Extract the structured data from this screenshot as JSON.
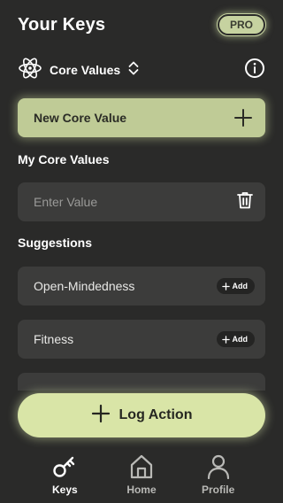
{
  "header": {
    "title": "Your Keys",
    "badge": "PRO"
  },
  "selector": {
    "label": "Core Values",
    "icon": "atom-icon"
  },
  "new_value_button": {
    "label": "New Core Value"
  },
  "my_values": {
    "title": "My Core Values",
    "input_placeholder": "Enter Value",
    "input_value": ""
  },
  "suggestions": {
    "title": "Suggestions",
    "add_label": "Add",
    "items": [
      {
        "label": "Open-Mindedness"
      },
      {
        "label": "Fitness"
      }
    ]
  },
  "log_action": {
    "label": "Log Action"
  },
  "nav": {
    "items": [
      {
        "label": "Keys",
        "icon": "key-icon",
        "active": true
      },
      {
        "label": "Home",
        "icon": "home-icon",
        "active": false
      },
      {
        "label": "Profile",
        "icon": "person-icon",
        "active": false
      }
    ]
  },
  "colors": {
    "background": "#2a2a29",
    "card": "#3c3c3b",
    "accent": "#bfcb96",
    "accent_light": "#d9e5a7"
  }
}
